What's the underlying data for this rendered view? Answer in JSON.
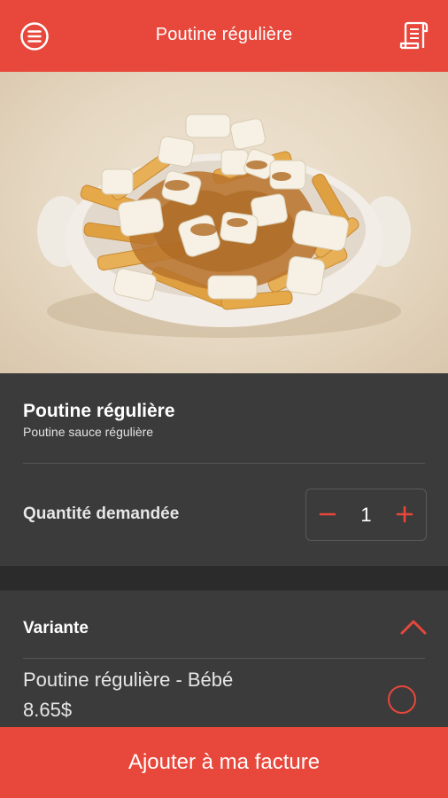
{
  "header": {
    "title": "Poutine régulière",
    "menu_icon": "menu-icon",
    "receipt_icon": "receipt-icon",
    "background_color": "#e8473b"
  },
  "product": {
    "image_alt": "poutine-image",
    "name": "Poutine régulière",
    "description": "Poutine sauce régulière"
  },
  "quantity": {
    "label": "Quantité demandée",
    "value": "1",
    "minus_icon": "minus-icon",
    "plus_icon": "plus-icon"
  },
  "variants": {
    "title": "Variante",
    "toggle_icon": "chevron-up-icon",
    "options": [
      {
        "name": "Poutine régulière - Bébé",
        "price": "8.65$",
        "selected": false
      }
    ]
  },
  "cta": {
    "label": "Ajouter à ma facture",
    "color": "#e8473b"
  },
  "theme": {
    "accent": "#e8473b",
    "panel": "#3b3b3b",
    "gap": "#2b2b2b"
  }
}
